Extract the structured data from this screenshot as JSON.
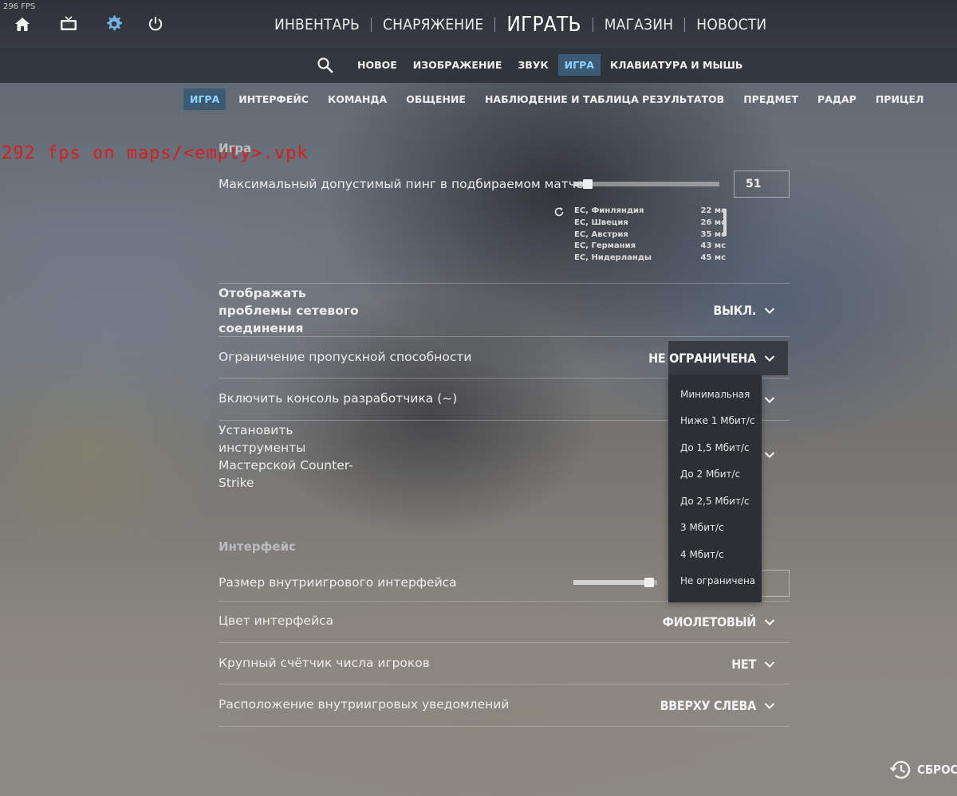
{
  "hud": {
    "fps_corner": "296 FPS",
    "console_overlay": "292 fps on maps/<empty>.vpk"
  },
  "top_icons": [
    "home-icon",
    "tv-icon",
    "gear-icon",
    "power-icon"
  ],
  "colors": {
    "accent": "#8fd3ff",
    "gear": "#6fb5e8",
    "active_tab_bg": "#3a5b73",
    "console_red": "#d81e1e"
  },
  "main_nav": {
    "inventory": "ИНВЕНТАРЬ",
    "loadout": "СНАРЯЖЕНИЕ",
    "play": "ИГРАТЬ",
    "store": "МАГАЗИН",
    "news": "НОВОСТИ"
  },
  "settings_tabs": [
    "НОВОЕ",
    "ИЗОБРАЖЕНИЕ",
    "ЗВУК",
    "ИГРА",
    "КЛАВИАТУРА И МЫШЬ"
  ],
  "settings_tabs_active": "ИГРА",
  "sub_tabs": [
    "ИГРА",
    "ИНТЕРФЕЙС",
    "КОМАНДА",
    "ОБЩЕНИЕ",
    "НАБЛЮДЕНИЕ И ТАБЛИЦА РЕЗУЛЬТАТОВ",
    "ПРЕДМЕТ",
    "РАДАР",
    "ПРИЦЕЛ"
  ],
  "sub_tabs_active": "ИГРА",
  "game_section": {
    "title": "Игра",
    "max_ping": {
      "label": "Максимальный допустимый пинг в подбираемом матче",
      "value": "51",
      "slider_fraction": 0.1
    },
    "ping_list": [
      {
        "region": "ЕС, Финляндия",
        "ping": "22 мс"
      },
      {
        "region": "ЕС, Швеция",
        "ping": "26 мс"
      },
      {
        "region": "ЕС, Австрия",
        "ping": "35 мс"
      },
      {
        "region": "ЕС, Германия",
        "ping": "43 мс"
      },
      {
        "region": "ЕС, Нидерланды",
        "ping": "45 мс"
      }
    ],
    "net_problems": {
      "label_lines": [
        "Отображать",
        "проблемы сетевого",
        "соединения"
      ],
      "value": "ВЫКЛ."
    },
    "bandwidth": {
      "label": "Ограничение пропускной способности",
      "value": "НЕ ОГРАНИЧЕНА"
    },
    "dev_console": {
      "label": "Включить консоль разработчика (~)"
    },
    "workshop_tools": {
      "label_lines": [
        "Установить",
        "инструменты",
        "Мастерской Counter-",
        "Strike"
      ]
    }
  },
  "bandwidth_options": [
    "Минимальная",
    "Ниже 1 Мбит/с",
    "До 1,5 Мбит/с",
    "До 2 Мбит/с",
    "До 2,5 Мбит/с",
    "3 Мбит/с",
    "4 Мбит/с",
    "Не ограничена"
  ],
  "interface_section": {
    "title": "Интерфейс",
    "hud_size": {
      "label": "Размер внутриигрового интерфейса",
      "slider_fraction": 0.9
    },
    "hud_color": {
      "label": "Цвет интерфейса",
      "value": "ФИОЛЕТОВЫЙ"
    },
    "big_player_count": {
      "label": "Крупный счётчик числа игроков",
      "value": "НЕТ"
    },
    "notif_position": {
      "label": "Расположение внутриигровых уведомлений",
      "value": "ВВЕРХУ СЛЕВА"
    }
  },
  "footer": {
    "reset_label": "СБРОС"
  }
}
